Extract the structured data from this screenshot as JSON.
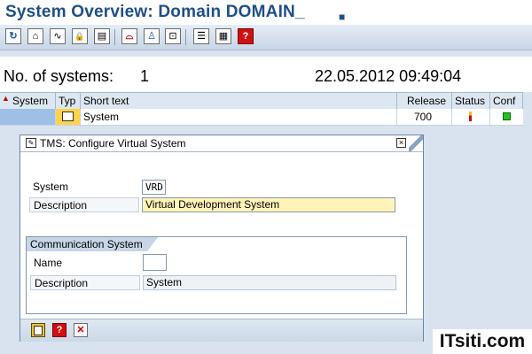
{
  "window": {
    "title": "System Overview: Domain DOMAIN_",
    "title_deco": "■"
  },
  "toolbar": {
    "buttons": [
      {
        "icon": "refresh-icon",
        "glyph": "↻"
      },
      {
        "icon": "system-icon",
        "glyph": "⌂"
      },
      {
        "icon": "transport-route-icon",
        "glyph": "∿"
      },
      {
        "icon": "lock-icon",
        "glyph": "🔒"
      },
      {
        "icon": "display-icon",
        "glyph": "▤"
      },
      {
        "icon": "hat-icon",
        "glyph": "⌓"
      },
      {
        "icon": "user-icon",
        "glyph": "♙"
      },
      {
        "icon": "virtual-system-icon",
        "glyph": "⊡"
      },
      {
        "icon": "details-icon",
        "glyph": "☰"
      },
      {
        "icon": "table-icon",
        "glyph": "▦"
      },
      {
        "icon": "help-icon",
        "glyph": "?"
      }
    ]
  },
  "summary": {
    "label": "No. of systems:",
    "count": "1",
    "timestamp": "22.05.2012 09:49:04"
  },
  "grid": {
    "columns": [
      "System",
      "Typ",
      "Short text",
      "Release",
      "Status",
      "Conf"
    ],
    "rows": [
      {
        "system": "",
        "short_text": "System",
        "release": "700",
        "type_icon": "virtual-system-icon",
        "status_icon": "status-indicator-icon",
        "conf_icon": "green-status-icon"
      }
    ]
  },
  "dialog": {
    "title": "TMS: Configure Virtual System",
    "close_glyph": "×",
    "system_label": "System",
    "system_value": "VRD",
    "description_label": "Description",
    "description_value": "Virtual Development System",
    "group_title": "Communication System",
    "name_label": "Name",
    "name_value": "",
    "comm_description_label": "Description",
    "comm_description_value": "System"
  },
  "footer": {
    "buttons": [
      {
        "icon": "save-icon",
        "glyph": "💾"
      },
      {
        "icon": "help-icon",
        "glyph": "?"
      },
      {
        "icon": "cancel-icon",
        "glyph": "✕"
      }
    ]
  },
  "watermark": {
    "text": "ITsiti.com"
  },
  "colors": {
    "title": "#1f4f86",
    "selection": "#9fc0e6",
    "required_field": "#fff4b8",
    "ok_status": "#1fc21f",
    "cancel": "#cc0000"
  }
}
